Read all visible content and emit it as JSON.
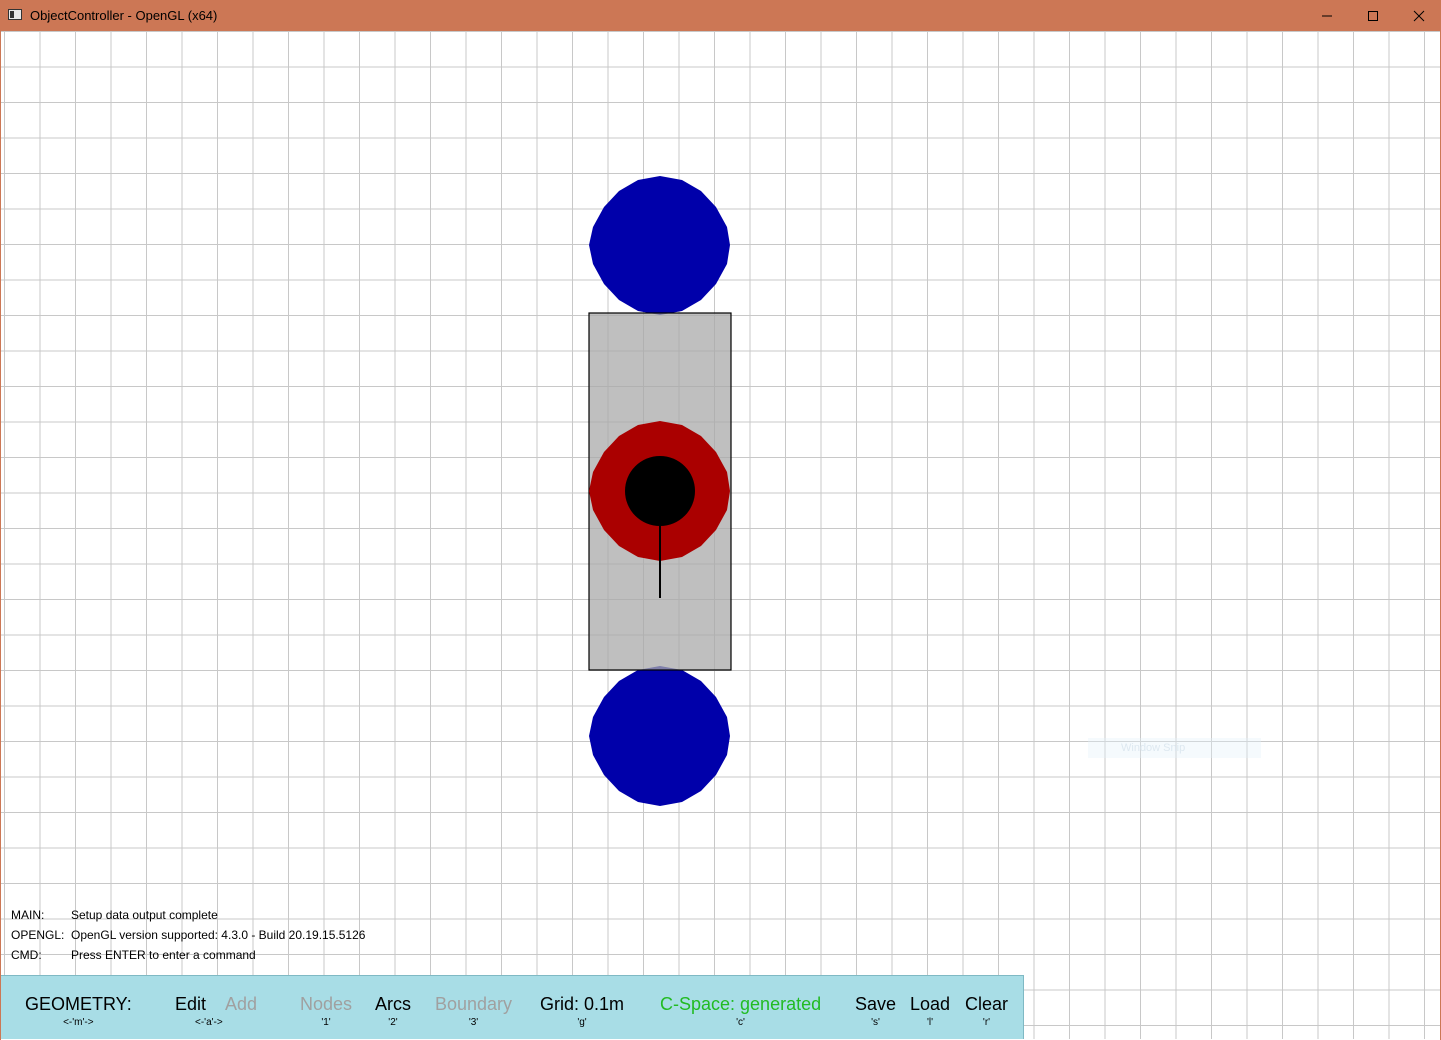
{
  "window": {
    "title": "ObjectController - OpenGL (x64)",
    "minimize_icon": "minimize-icon",
    "maximize_icon": "maximize-icon",
    "close_icon": "close-icon"
  },
  "canvas": {
    "grid_color": "#c8c8c8",
    "scene_colors": {
      "wheel": "#0000aa",
      "body": "#c0c0c0",
      "ring": "#aa0000",
      "core": "#000000"
    }
  },
  "console": {
    "lines": [
      {
        "tag": "MAIN:",
        "message": "Setup data output complete"
      },
      {
        "tag": "OPENGL:",
        "message": "OpenGL version supported: 4.3.0 - Build 20.19.15.5126"
      },
      {
        "tag": "CMD:",
        "message": "Press ENTER to enter a command"
      }
    ]
  },
  "overlay": {
    "snip_text": "Window Snip"
  },
  "toolbar": {
    "mode_label": "GEOMETRY:",
    "mode_key": "<-'m'->",
    "edit_label": "Edit",
    "add_label": "Add",
    "edit_add_key": "<-'a'->",
    "nodes_label": "Nodes",
    "nodes_key": "'1'",
    "arcs_label": "Arcs",
    "arcs_key": "'2'",
    "boundary_label": "Boundary",
    "boundary_key": "'3'",
    "grid_label": "Grid: 0.1m",
    "grid_key": "'g'",
    "cspace_label": "C-Space: generated",
    "cspace_key": "'c'",
    "save_label": "Save",
    "save_key": "'s'",
    "load_label": "Load",
    "load_key": "'l'",
    "clear_label": "Clear",
    "clear_key": "'r'",
    "accent_color": "#22bb22",
    "disabled_color": "#a0a0a0",
    "background": "#a8dde6"
  }
}
